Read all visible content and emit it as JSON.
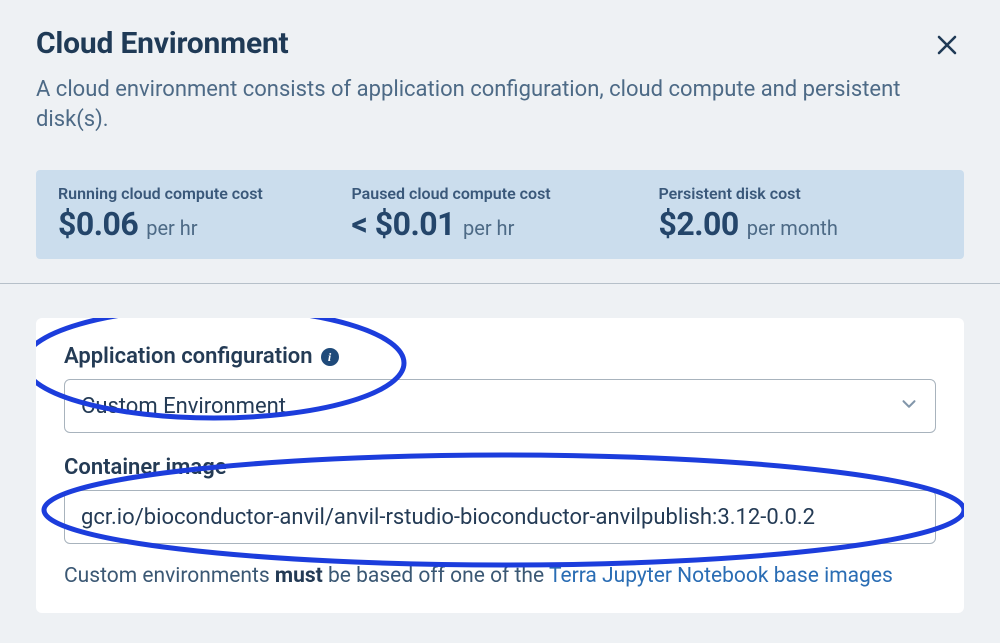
{
  "header": {
    "title": "Cloud Environment",
    "subtitle": "A cloud environment consists of application configuration, cloud compute and persistent disk(s)."
  },
  "costs": {
    "running": {
      "label": "Running cloud compute cost",
      "amount": "$0.06",
      "unit": "per hr"
    },
    "paused": {
      "label": "Paused cloud compute cost",
      "amount": "< $0.01",
      "unit": "per hr"
    },
    "disk": {
      "label": "Persistent disk cost",
      "amount": "$2.00",
      "unit": "per month"
    }
  },
  "form": {
    "app_config_label": "Application configuration",
    "app_config_value": "Custom Environment",
    "container_image_label": "Container image",
    "container_image_value": "gcr.io/bioconductor-anvil/anvil-rstudio-bioconductor-anvilpublish:3.12-0.0.2",
    "note_prefix": "Custom environments ",
    "note_must": "must",
    "note_mid": " be based off one of the ",
    "note_link": "Terra Jupyter Notebook base images"
  }
}
